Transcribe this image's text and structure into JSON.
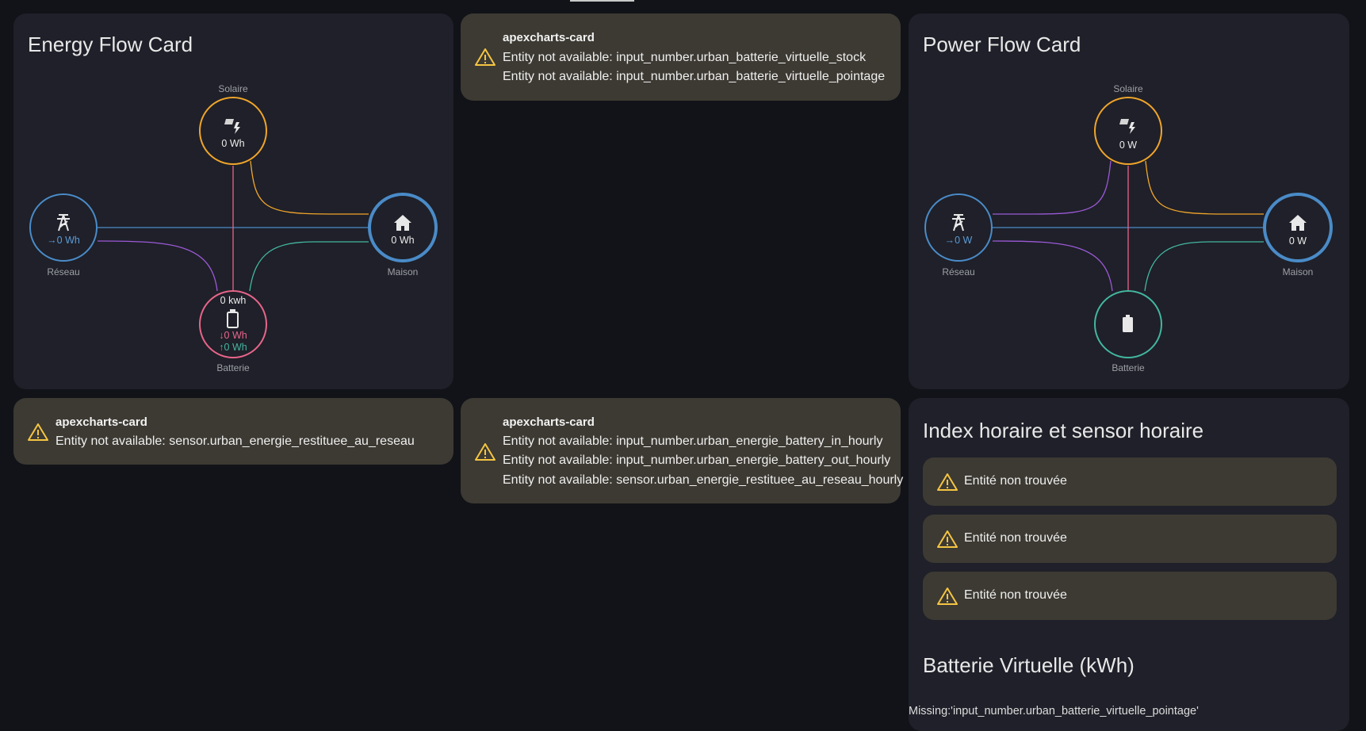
{
  "energy_flow_card": {
    "title": "Energy Flow Card",
    "solar": {
      "label": "Solaire",
      "value": "0 Wh"
    },
    "grid": {
      "label": "Réseau",
      "value": "0 Wh"
    },
    "home": {
      "label": "Maison",
      "value": "0 Wh"
    },
    "battery": {
      "label": "Batterie",
      "stock": "0 kwh",
      "in": "0 Wh",
      "out": "0 Wh"
    }
  },
  "apex_stock": {
    "title": "apexcharts-card",
    "lines": [
      "Entity not available: input_number.urban_batterie_virtuelle_stock",
      "Entity not available: input_number.urban_batterie_virtuelle_pointage"
    ]
  },
  "power_flow_card": {
    "title": "Power Flow Card",
    "solar": {
      "label": "Solaire",
      "value": "0 W"
    },
    "grid": {
      "label": "Réseau",
      "value": "0 W"
    },
    "home": {
      "label": "Maison",
      "value": "0 W"
    },
    "battery": {
      "label": "Batterie"
    }
  },
  "apex_restituee": {
    "title": "apexcharts-card",
    "lines": [
      "Entity not available: sensor.urban_energie_restituee_au_reseau"
    ]
  },
  "apex_hourly": {
    "title": "apexcharts-card",
    "lines": [
      "Entity not available: input_number.urban_energie_battery_in_hourly",
      "Entity not available: input_number.urban_energie_battery_out_hourly",
      "Entity not available: sensor.urban_energie_restituee_au_reseau_hourly"
    ]
  },
  "index_card": {
    "title": "Index horaire et sensor horaire",
    "rows": [
      "Entité non trouvée",
      "Entité non trouvée",
      "Entité non trouvée"
    ]
  },
  "battery_virtual_card": {
    "title": "Batterie Virtuelle (kWh)",
    "missing": "Missing:'input_number.urban_batterie_virtuelle_pointage'"
  },
  "colors": {
    "solar": "#f0a52a",
    "grid": "#4a8bc8",
    "home": "#4a8bc8",
    "battery_energy": "#e8658a",
    "battery_power": "#43b6a0",
    "warning": "#f5c542",
    "card_bg": "#1f2029",
    "warn_bg": "#3d3a33"
  },
  "icons": [
    "solar-panel-icon",
    "transmission-tower-icon",
    "home-icon",
    "battery-icon",
    "warning-icon"
  ]
}
